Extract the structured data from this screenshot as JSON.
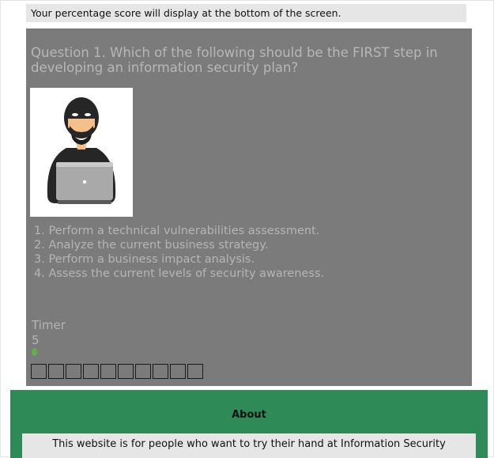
{
  "score_notice": "Your percentage score will display at the bottom of the screen.",
  "question": {
    "text": "Question 1. Which of the following should be the FIRST step in developing an information security plan?",
    "image_icon": "hacker-with-laptop-icon"
  },
  "answers": [
    "1. Perform a technical vulnerabilities assessment.",
    "2. Analyze the current business strategy.",
    "3. Perform a business impact analysis.",
    "4. Assess the current levels of security awareness."
  ],
  "timer": {
    "label": "Timer",
    "value": "5",
    "indicator_color": "#5db340"
  },
  "progress": {
    "total_questions": 10,
    "answered": 0
  },
  "about": {
    "title": "About",
    "text": "This website is for people who want to try their hand at Information Security"
  },
  "colors": {
    "quiz_panel": "#7b7b7b",
    "about_section": "#2e8b57",
    "notice_bg": "#e6e6e6"
  }
}
